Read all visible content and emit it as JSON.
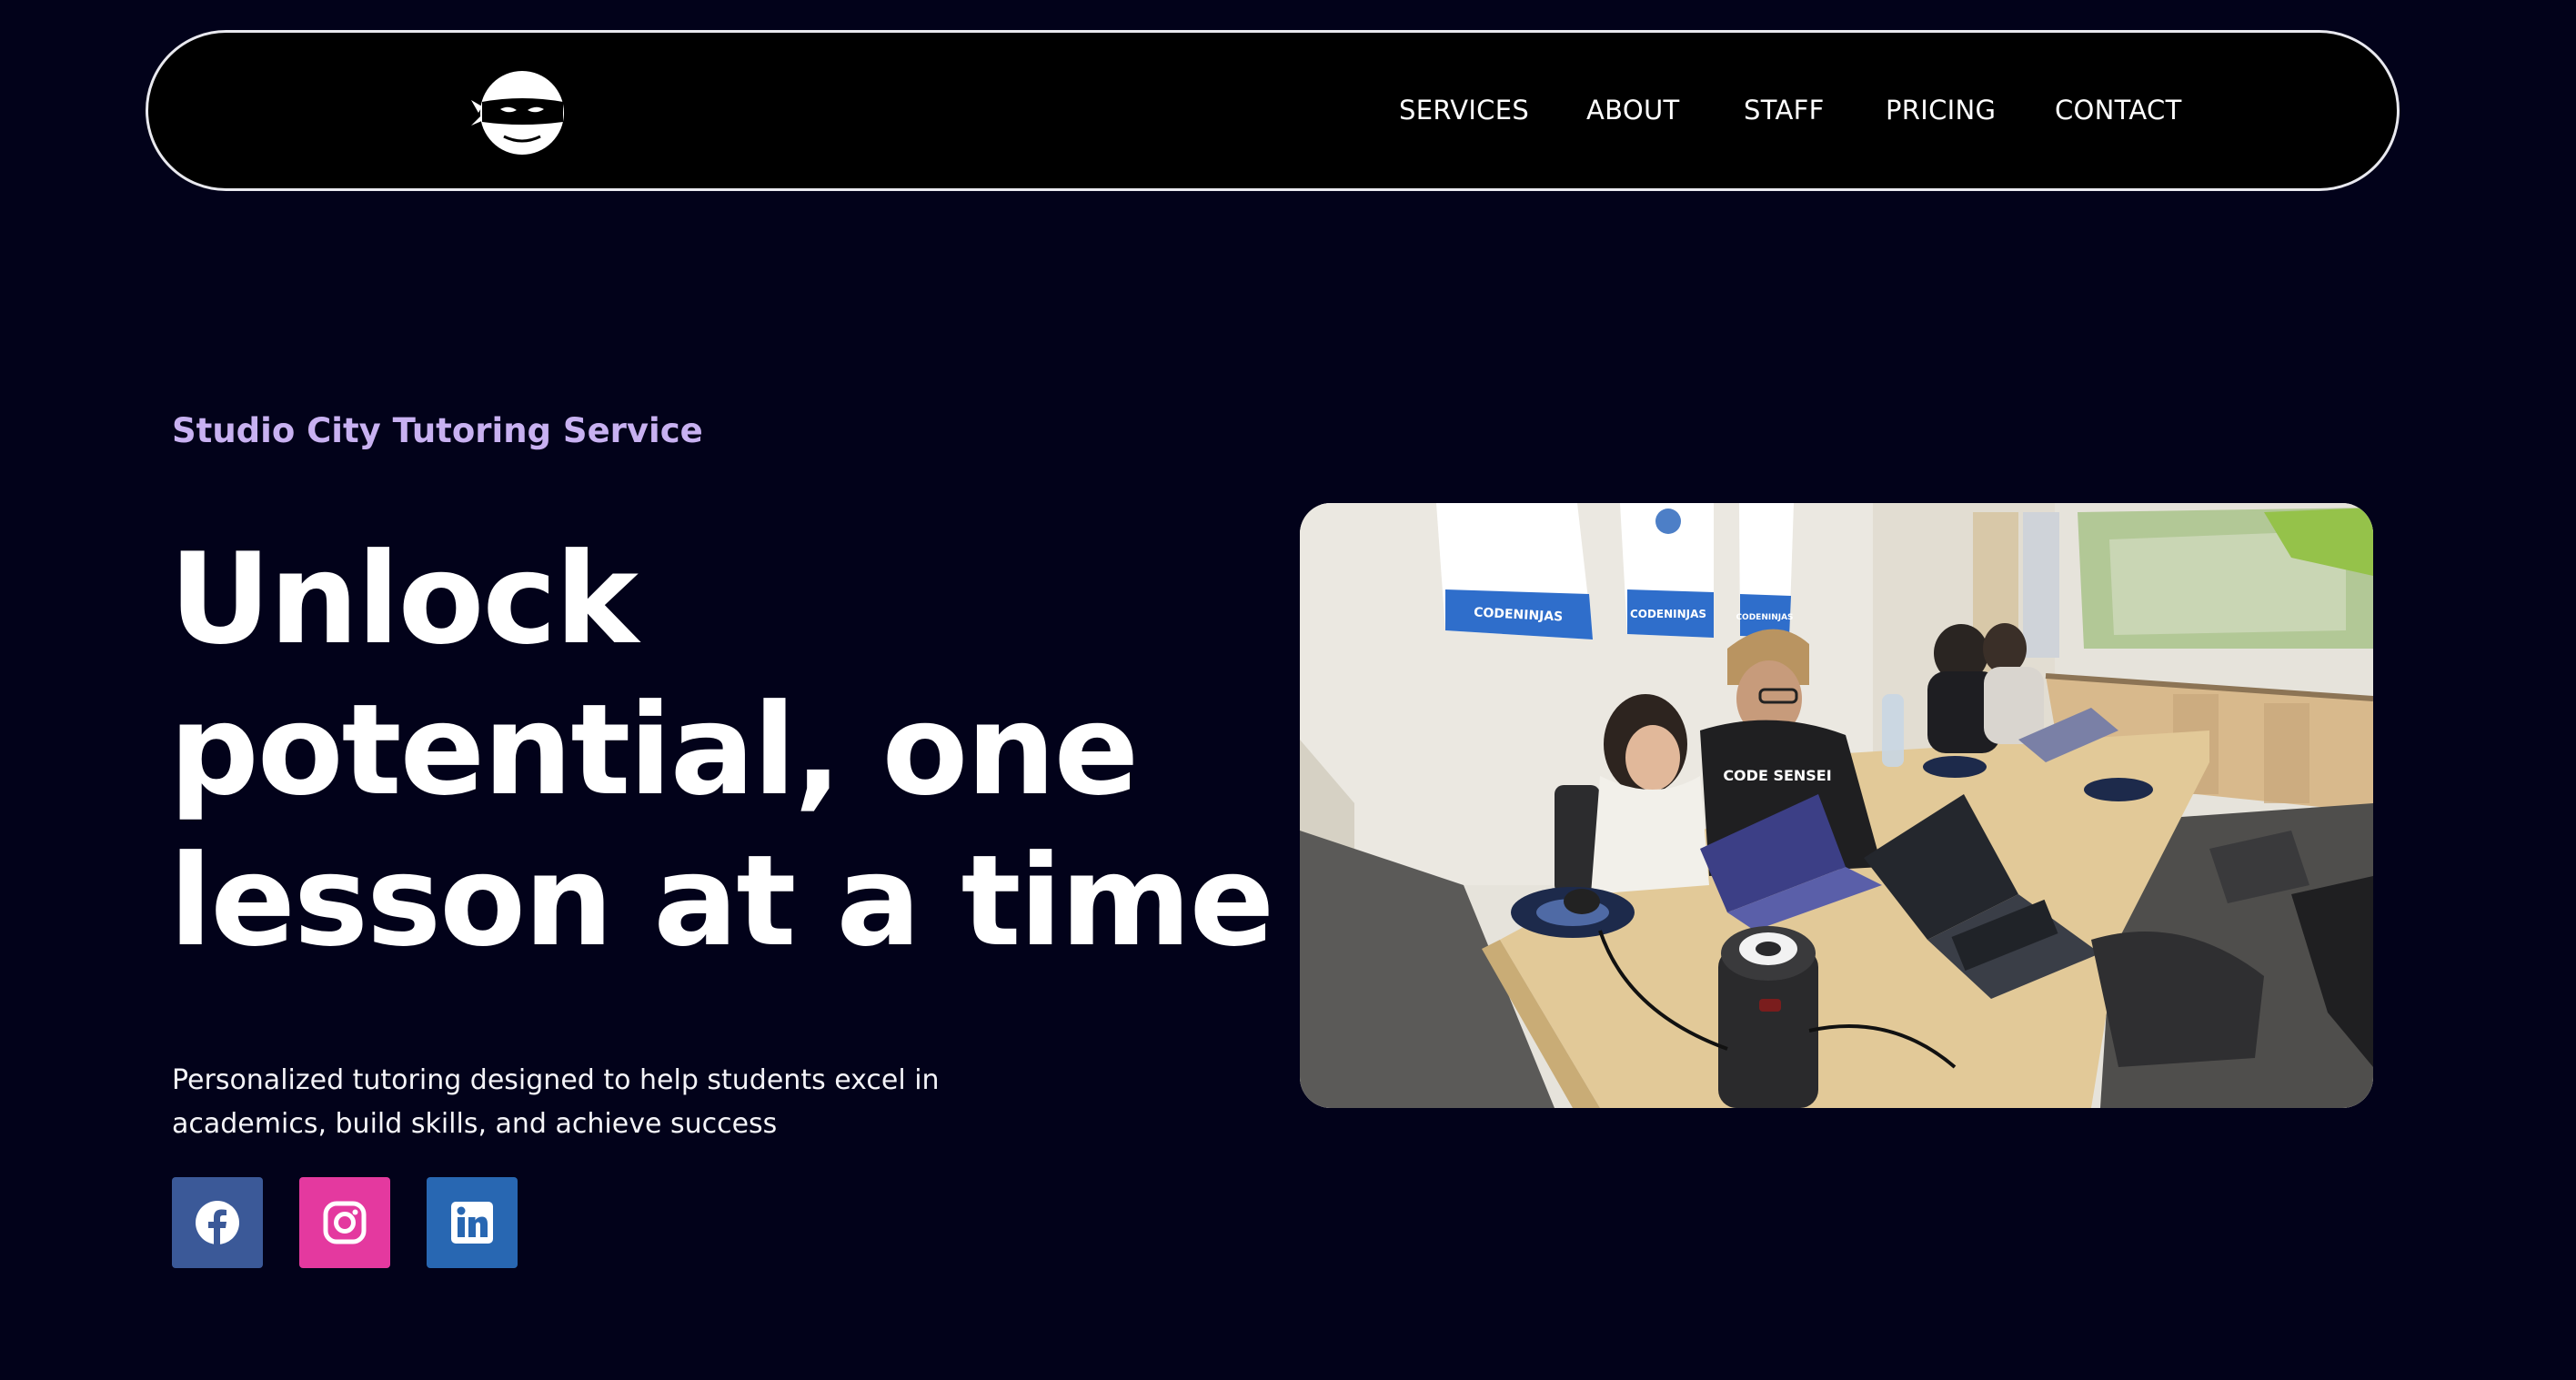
{
  "nav": {
    "logo_icon": "ninja-icon",
    "links": [
      {
        "label": "SERVICES"
      },
      {
        "label": "ABOUT"
      },
      {
        "label": "STAFF"
      },
      {
        "label": "PRICING"
      },
      {
        "label": "CONTACT"
      }
    ]
  },
  "hero": {
    "eyebrow": "Studio City Tutoring Service",
    "headline": "Unlock potential, one lesson at a time",
    "description": "Personalized tutoring designed to help students excel in academics, build skills, and achieve success",
    "image_icon": "photo-tutoring-session",
    "banners": [
      {
        "brand_plain": "CODE",
        "brand_bold": "NINJAS"
      },
      {
        "brand_plain": "CODE",
        "brand_bold": "NINJAS"
      },
      {
        "brand_plain": "CODE",
        "brand_bold": "NINJAS"
      }
    ],
    "shirt_text": "CODE SENSEI"
  },
  "social": [
    {
      "icon": "facebook-icon",
      "color": "#3b5998"
    },
    {
      "icon": "instagram-icon",
      "color": "#e4399f"
    },
    {
      "icon": "linkedin-icon",
      "color": "#2867b2"
    }
  ],
  "colors": {
    "background": "#02021a",
    "nav_background": "#000000",
    "accent": "#c8b1f1"
  }
}
